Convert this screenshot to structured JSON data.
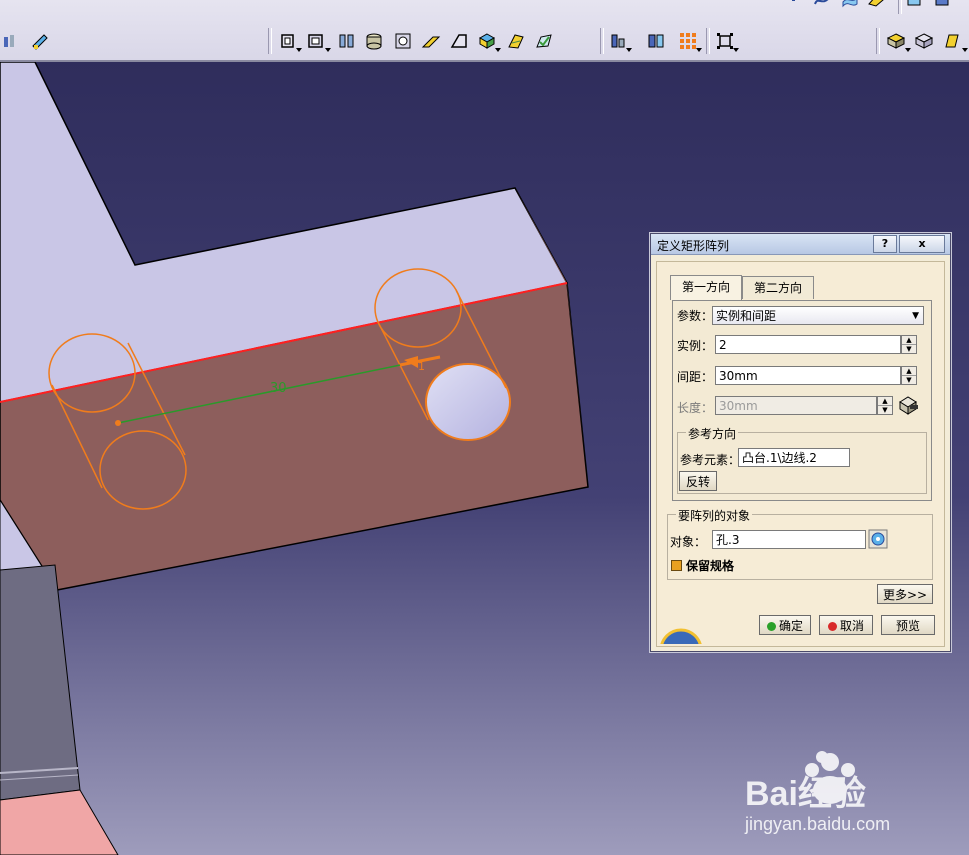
{
  "dialog": {
    "title": "定义矩形阵列",
    "help_label": "?",
    "close_label": "x",
    "tabs": [
      {
        "label": "第一方向"
      },
      {
        "label": "第二方向"
      }
    ],
    "params_label": "参数：",
    "params_value": "实例和间距",
    "instances_label": "实例：",
    "instances_value": "2",
    "spacing_label": "间距：",
    "spacing_value": "30mm",
    "length_label": "长度：",
    "length_value": "30mm",
    "ref_direction": {
      "title": "参考方向",
      "element_label": "参考元素：",
      "element_value": "凸台.1\\边线.2",
      "reverse_label": "反转"
    },
    "pattern_object": {
      "title": "要阵列的对象",
      "object_label": "对象：",
      "object_value": "孔.3",
      "keep_spec_label": "保留规格"
    },
    "more_label": "更多>>",
    "ok_label": "确定",
    "cancel_label": "取消",
    "preview_label": "预览"
  },
  "viewport": {
    "dimension_label": "30",
    "instance_label": "1"
  },
  "watermark": {
    "brand": "Bai经验",
    "url": "jingyan.baidu.com"
  },
  "colors": {
    "background_top": "#2f2d5c",
    "background_bottom": "#9492b8",
    "part_top": "#c9c6e6",
    "part_face": "#8d5e5c",
    "highlight": "#f07c1c",
    "edge_red": "#ff2020",
    "dimension_green": "#2a9a2a"
  }
}
